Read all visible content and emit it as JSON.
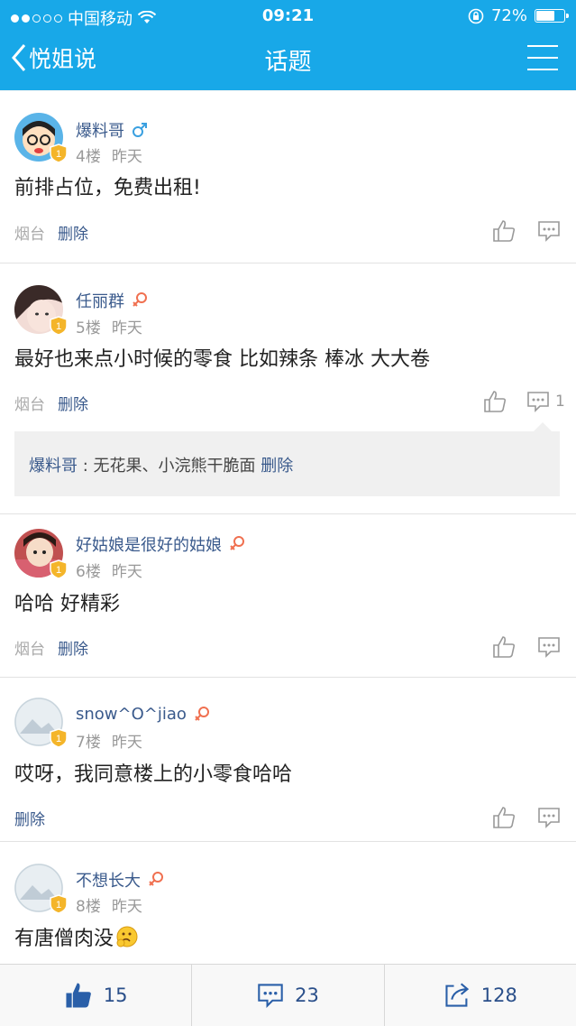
{
  "status": {
    "carrier": "中国移动",
    "time": "09:21",
    "battery": "72%",
    "battery_level": 0.72
  },
  "nav": {
    "back_label": "悦姐说",
    "title": "话题"
  },
  "labels": {
    "delete": "删除",
    "comma_colon": ":"
  },
  "posts": [
    {
      "name": "爆料哥",
      "gender": "male",
      "floor": "4楼",
      "when": "昨天",
      "content": "前排占位，免费出租!",
      "location": "烟台",
      "reply_count": ""
    },
    {
      "name": "任丽群",
      "gender": "female",
      "floor": "5楼",
      "when": "昨天",
      "content": "最好也来点小时候的零食 比如辣条 棒冰 大大卷",
      "location": "烟台",
      "reply_count": "1",
      "reply": {
        "name": "爆料哥",
        "sep": ":",
        "text": "无花果、小浣熊干脆面",
        "delete": "删除"
      }
    },
    {
      "name": "好姑娘是很好的姑娘",
      "gender": "female",
      "floor": "6楼",
      "when": "昨天",
      "content": "哈哈 好精彩",
      "location": "烟台",
      "reply_count": ""
    },
    {
      "name": "snow^O^jiao",
      "gender": "female",
      "floor": "7楼",
      "when": "昨天",
      "content": "哎呀，我同意楼上的小零食哈哈",
      "location": "",
      "reply_count": ""
    },
    {
      "name": "不想长大",
      "gender": "female",
      "floor": "8楼",
      "when": "昨天",
      "content": "有唐僧肉没",
      "location": "",
      "reply_count": ""
    }
  ],
  "bottom": {
    "likes": "15",
    "comments": "23",
    "shares": "128"
  },
  "colors": {
    "header": "#18a8e8",
    "link": "#3a5a8c",
    "male": "#3aa0e0",
    "female": "#f07050",
    "badge": "#f4b52a"
  }
}
